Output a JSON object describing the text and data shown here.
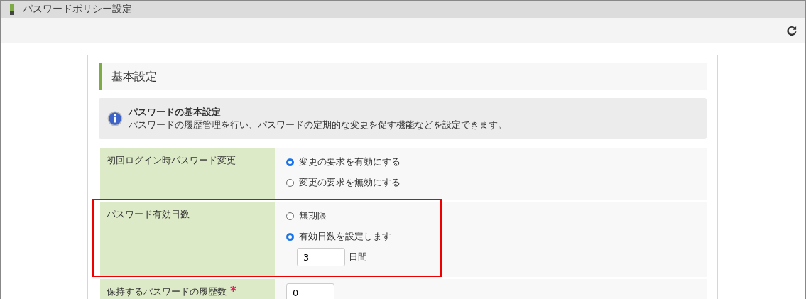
{
  "window": {
    "title": "パスワードポリシー設定"
  },
  "section": {
    "title": "基本設定"
  },
  "info": {
    "title": "パスワードの基本設定",
    "text": "パスワードの履歴管理を行い、パスワードの定期的な変更を促す機能などを設定できます。"
  },
  "rows": [
    {
      "label": "初回ログイン時パスワード変更",
      "required": false,
      "highlighted": false,
      "options": [
        {
          "label": "変更の要求を有効にする",
          "selected": true
        },
        {
          "label": "変更の要求を無効にする",
          "selected": false
        }
      ]
    },
    {
      "label": "パスワード有効日数",
      "required": false,
      "highlighted": true,
      "options": [
        {
          "label": "無期限",
          "selected": false
        },
        {
          "label": "有効日数を設定します",
          "selected": true
        }
      ],
      "field": {
        "value": "3",
        "unit": "日間"
      }
    },
    {
      "label": "保持するパスワードの履歴数",
      "required": true,
      "highlighted": false,
      "field": {
        "value": "0"
      }
    }
  ]
}
